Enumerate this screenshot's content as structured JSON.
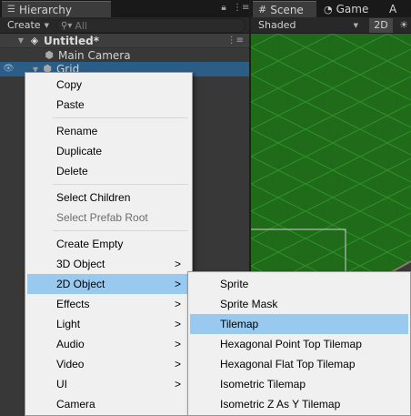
{
  "hierarchy": {
    "tab_label": "Hierarchy",
    "create_label": "Create",
    "search_placeholder": "All",
    "scene_name": "Untitled*",
    "items": [
      "Main Camera",
      "Grid"
    ]
  },
  "scene_view": {
    "tabs": [
      "Scene",
      "Game",
      "A"
    ],
    "shading_mode": "Shaded",
    "mode_2d_label": "2D"
  },
  "context_menu": {
    "items": [
      {
        "label": "Copy"
      },
      {
        "label": "Paste"
      },
      {
        "label": "Rename"
      },
      {
        "label": "Duplicate"
      },
      {
        "label": "Delete"
      },
      {
        "label": "Select Children"
      },
      {
        "label": "Select Prefab Root",
        "disabled": true
      },
      {
        "label": "Create Empty"
      },
      {
        "label": "3D Object",
        "submenu": true
      },
      {
        "label": "2D Object",
        "submenu": true,
        "highlighted": true
      },
      {
        "label": "Effects",
        "submenu": true
      },
      {
        "label": "Light",
        "submenu": true
      },
      {
        "label": "Audio",
        "submenu": true
      },
      {
        "label": "Video",
        "submenu": true
      },
      {
        "label": "UI",
        "submenu": true
      },
      {
        "label": "Camera"
      }
    ],
    "submenu_arrow": ">"
  },
  "submenu_2d": {
    "items": [
      {
        "label": "Sprite"
      },
      {
        "label": "Sprite Mask"
      },
      {
        "label": "Tilemap",
        "highlighted": true
      },
      {
        "label": "Hexagonal Point Top Tilemap"
      },
      {
        "label": "Hexagonal Flat Top Tilemap"
      },
      {
        "label": "Isometric Tilemap"
      },
      {
        "label": "Isometric Z As Y Tilemap"
      }
    ]
  },
  "colors": {
    "editor_bg": "#383838",
    "selection": "#2c5d87",
    "menu_bg": "#f0f0f0",
    "menu_highlight": "#99c9ef",
    "grid_green": "#1f6b1a"
  },
  "icons": {
    "hierarchy_tab": "list-icon",
    "scene_tab": "grid-icon",
    "game_tab": "pacman-icon",
    "scene_object": "unity-logo-icon",
    "game_object": "cube-icon",
    "visibility": "eye-icon",
    "lock": "lock-icon",
    "search": "search-icon"
  }
}
